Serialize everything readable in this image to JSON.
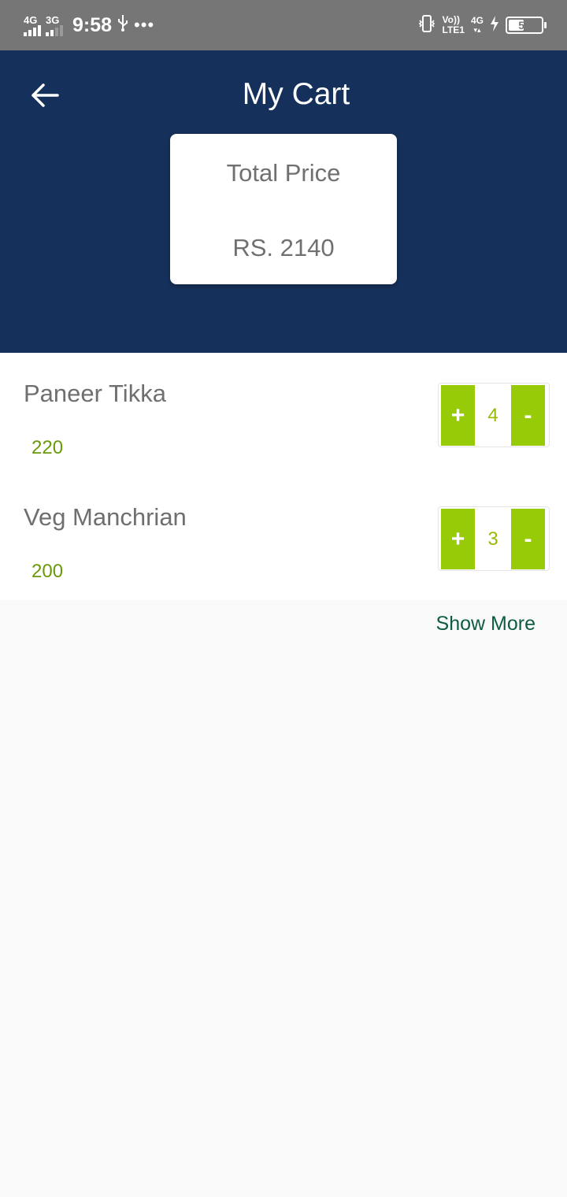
{
  "status_bar": {
    "net1": "4G",
    "net2": "3G",
    "time": "9:58",
    "volte_top": "Vo))",
    "volte_bottom": "LTE1",
    "net3": "4G",
    "battery": "54",
    "battery_level": 0.54,
    "icons": [
      "usb-icon",
      "more-dots-icon",
      "vibrate-icon",
      "charging-icon",
      "battery-icon"
    ]
  },
  "header": {
    "title": "My Cart",
    "background": "#15305a",
    "total_label": "Total Price",
    "total_value": "RS. 2140"
  },
  "cart": {
    "items": [
      {
        "name": "Paneer Tikka",
        "price": "220",
        "quantity": "4",
        "plus": "+",
        "minus": "-"
      },
      {
        "name": "Veg Manchrian",
        "price": "200",
        "quantity": "3",
        "plus": "+",
        "minus": "-"
      }
    ],
    "accent": "#97cb08"
  },
  "show_more": "Show More"
}
